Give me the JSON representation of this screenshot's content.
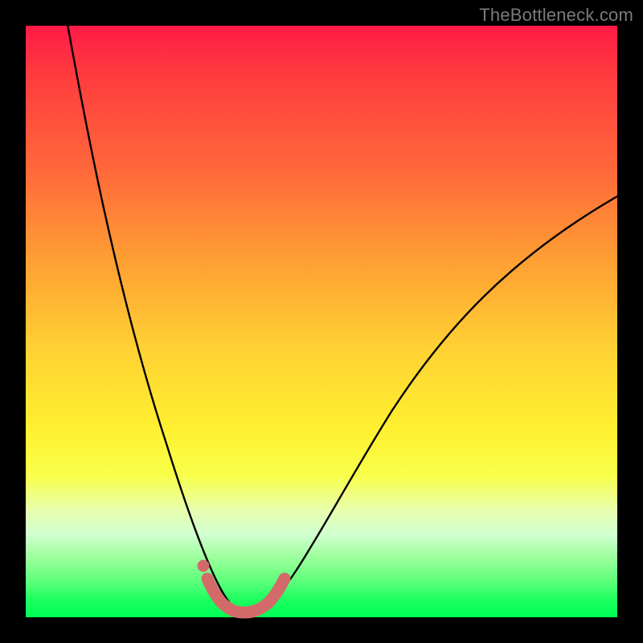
{
  "watermark": "TheBottleneck.com",
  "colors": {
    "frame": "#000000",
    "curve_stroke": "#000000",
    "marker_fill": "#d36a6a",
    "marker_stroke": "#d36a6a",
    "gradient_stops": [
      "#ff1a46",
      "#ff3a3f",
      "#ff6a3a",
      "#ffa033",
      "#ffd233",
      "#fff030",
      "#f8ff4a",
      "#e8ffb0",
      "#d0ffd0",
      "#9bff9b",
      "#5bff7a",
      "#1cff5f",
      "#00ff55"
    ]
  },
  "chart_data": {
    "type": "line",
    "title": "",
    "xlabel": "",
    "ylabel": "",
    "xlim": [
      0,
      1
    ],
    "ylim": [
      0,
      1
    ],
    "x": [
      0.0,
      0.02,
      0.04,
      0.06,
      0.08,
      0.1,
      0.12,
      0.14,
      0.16,
      0.18,
      0.2,
      0.22,
      0.24,
      0.26,
      0.28,
      0.3,
      0.32,
      0.34,
      0.35,
      0.36,
      0.37,
      0.38,
      0.4,
      0.42,
      0.44,
      0.46,
      0.5,
      0.55,
      0.6,
      0.65,
      0.7,
      0.75,
      0.8,
      0.85,
      0.9,
      0.95,
      1.0
    ],
    "values": [
      1.0,
      0.92,
      0.84,
      0.77,
      0.7,
      0.63,
      0.56,
      0.49,
      0.43,
      0.36,
      0.3,
      0.24,
      0.19,
      0.14,
      0.1,
      0.06,
      0.03,
      0.01,
      0.0,
      0.0,
      0.0,
      0.005,
      0.015,
      0.03,
      0.05,
      0.08,
      0.14,
      0.22,
      0.3,
      0.38,
      0.45,
      0.52,
      0.58,
      0.64,
      0.69,
      0.73,
      0.77
    ],
    "highlight_segment": {
      "x": [
        0.3,
        0.31,
        0.32,
        0.33,
        0.34,
        0.35,
        0.36,
        0.37,
        0.38,
        0.39,
        0.4,
        0.41,
        0.42
      ],
      "y": [
        0.065,
        0.048,
        0.033,
        0.02,
        0.01,
        0.004,
        0.002,
        0.004,
        0.01,
        0.02,
        0.033,
        0.048,
        0.065
      ]
    },
    "highlight_point": {
      "x": 0.295,
      "y": 0.08
    }
  }
}
